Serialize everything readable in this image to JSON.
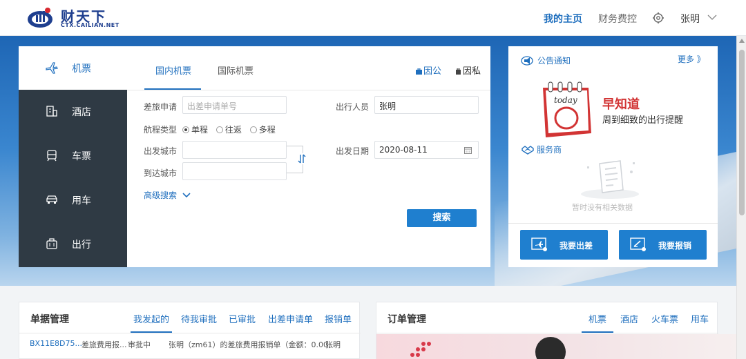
{
  "header": {
    "logo_text": "财天下",
    "logo_sub": "CTX.CAILIAN.NET",
    "nav": [
      "我的主页",
      "财务费控"
    ],
    "user": "张明"
  },
  "booking": {
    "side_items": [
      {
        "label": "机票",
        "icon": "plane-icon"
      },
      {
        "label": "酒店",
        "icon": "hotel-icon"
      },
      {
        "label": "车票",
        "icon": "train-icon"
      },
      {
        "label": "用车",
        "icon": "car-icon"
      },
      {
        "label": "出行",
        "icon": "luggage-icon"
      }
    ],
    "tabs": [
      "国内机票",
      "国际机票"
    ],
    "trip_purpose": {
      "business": "因公",
      "private": "因私"
    },
    "fields": {
      "travel_request_label": "差旅申请",
      "travel_request_placeholder": "出差申请单号",
      "route_type_label": "航程类型",
      "route_options": [
        "单程",
        "往返",
        "多程"
      ],
      "from_label": "出发城市",
      "to_label": "到达城市",
      "traveler_label": "出行人员",
      "traveler_value": "张明",
      "date_label": "出发日期",
      "date_value": "2020-08-11"
    },
    "advanced_search": "高级搜索",
    "search_button": "搜索"
  },
  "notice": {
    "title": "公告通知",
    "more": "更多 》",
    "calendar_word": "today",
    "promo_title": "早知道",
    "promo_subtitle": "周到细致的出行提醒",
    "service_title": "服务商",
    "empty_text": "暂时没有相关数据",
    "btn_trip": "我要出差",
    "btn_reimburse": "我要报销"
  },
  "docs": {
    "title": "单据管理",
    "tabs": [
      "我发起的",
      "待我审批",
      "已审批",
      "出差申请单",
      "报销单"
    ],
    "row": {
      "id": "BX11E8D75...",
      "type": "差旅费用报...",
      "status": "审批中",
      "desc": "张明（zm61）的差旅费用报销单（金额：0.00...",
      "person": "张明"
    }
  },
  "orders": {
    "title": "订单管理",
    "tabs": [
      "机票",
      "酒店",
      "火车票",
      "用车"
    ]
  }
}
